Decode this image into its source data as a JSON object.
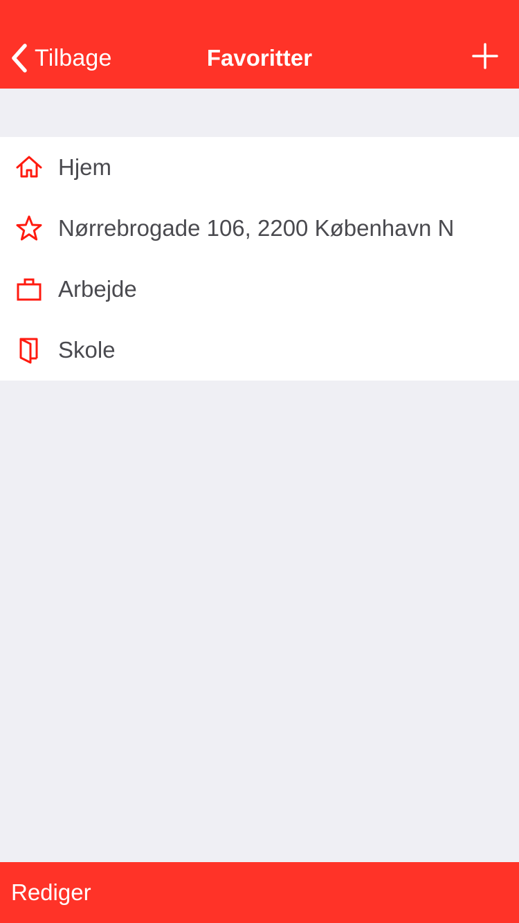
{
  "colors": {
    "accent": "#FF3328",
    "background": "#EFEFF4",
    "list_background": "#FFFFFF",
    "item_text": "#4A4A4F",
    "nav_text": "#FFFFFF"
  },
  "nav": {
    "back_icon": "chevron-left-icon",
    "back_label": "Tilbage",
    "title": "Favoritter",
    "add_icon": "plus-icon"
  },
  "favorites": [
    {
      "icon": "home-icon",
      "label": "Hjem"
    },
    {
      "icon": "star-icon",
      "label": "Nørrebrogade 106, 2200 København N"
    },
    {
      "icon": "briefcase-icon",
      "label": "Arbejde"
    },
    {
      "icon": "book-icon",
      "label": "Skole"
    }
  ],
  "toolbar": {
    "edit_label": "Rediger"
  }
}
